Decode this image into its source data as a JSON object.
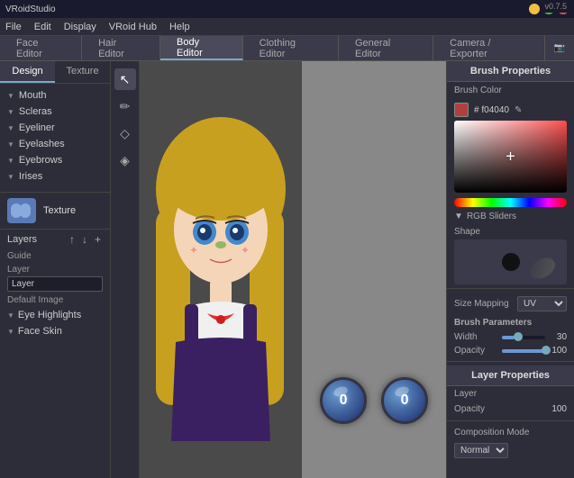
{
  "app": {
    "title": "VRoidStudio",
    "version": "v0.7.5"
  },
  "title_bar": {
    "title": "VRoidStudio",
    "btn_min": "−",
    "btn_max": "□",
    "btn_close": "×"
  },
  "menu": {
    "items": [
      "File",
      "Edit",
      "Display",
      "VRoid Hub",
      "Help"
    ]
  },
  "tabs": {
    "items": [
      "Face Editor",
      "Hair Editor",
      "Body Editor",
      "Clothing Editor",
      "General Editor",
      "Camera / Exporter"
    ]
  },
  "active_tab": "Body Editor",
  "left_panel": {
    "design_tab": "Design",
    "texture_tab": "Texture",
    "categories": [
      {
        "label": "Mouth"
      },
      {
        "label": "Scleras"
      },
      {
        "label": "Eyeliner"
      },
      {
        "label": "Eyelashes"
      },
      {
        "label": "Eyebrows"
      },
      {
        "label": "Irises"
      }
    ],
    "texture_label": "Texture",
    "layers_label": "Layers",
    "arrow_up": "↑",
    "arrow_down": "↓",
    "add": "+",
    "guide_label": "Guide",
    "layer_label": "Layer",
    "default_image_label": "Default Image",
    "sub_categories": [
      {
        "label": "Eye Highlights"
      },
      {
        "label": "Face Skin"
      }
    ]
  },
  "tools": {
    "items": [
      {
        "name": "cursor-tool",
        "icon": "↖",
        "active": true
      },
      {
        "name": "pencil-tool",
        "icon": "✏"
      },
      {
        "name": "eraser-tool",
        "icon": "◇"
      },
      {
        "name": "droplet-tool",
        "icon": "◈"
      }
    ]
  },
  "right_panel": {
    "brush_properties_title": "Brush Properties",
    "brush_color_label": "Brush Color",
    "color_hex": "# f04040",
    "edit_icon": "✎",
    "rgb_sliders_label": "RGB Sliders",
    "shape_label": "Shape",
    "size_mapping_label": "Size Mapping",
    "size_mapping_value": "UV",
    "brush_parameters_label": "Brush Parameters",
    "width_label": "Width",
    "width_value": "30",
    "opacity_label": "Opacity",
    "opacity_value": "100",
    "layer_properties_title": "Layer Properties",
    "layer_label": "Layer",
    "layer_opacity_label": "Opacity",
    "layer_opacity_value": "100",
    "composition_mode_label": "Composition Mode",
    "composition_mode_value": "Normal"
  },
  "orbs": [
    {
      "symbol": "0"
    },
    {
      "symbol": "0"
    }
  ]
}
